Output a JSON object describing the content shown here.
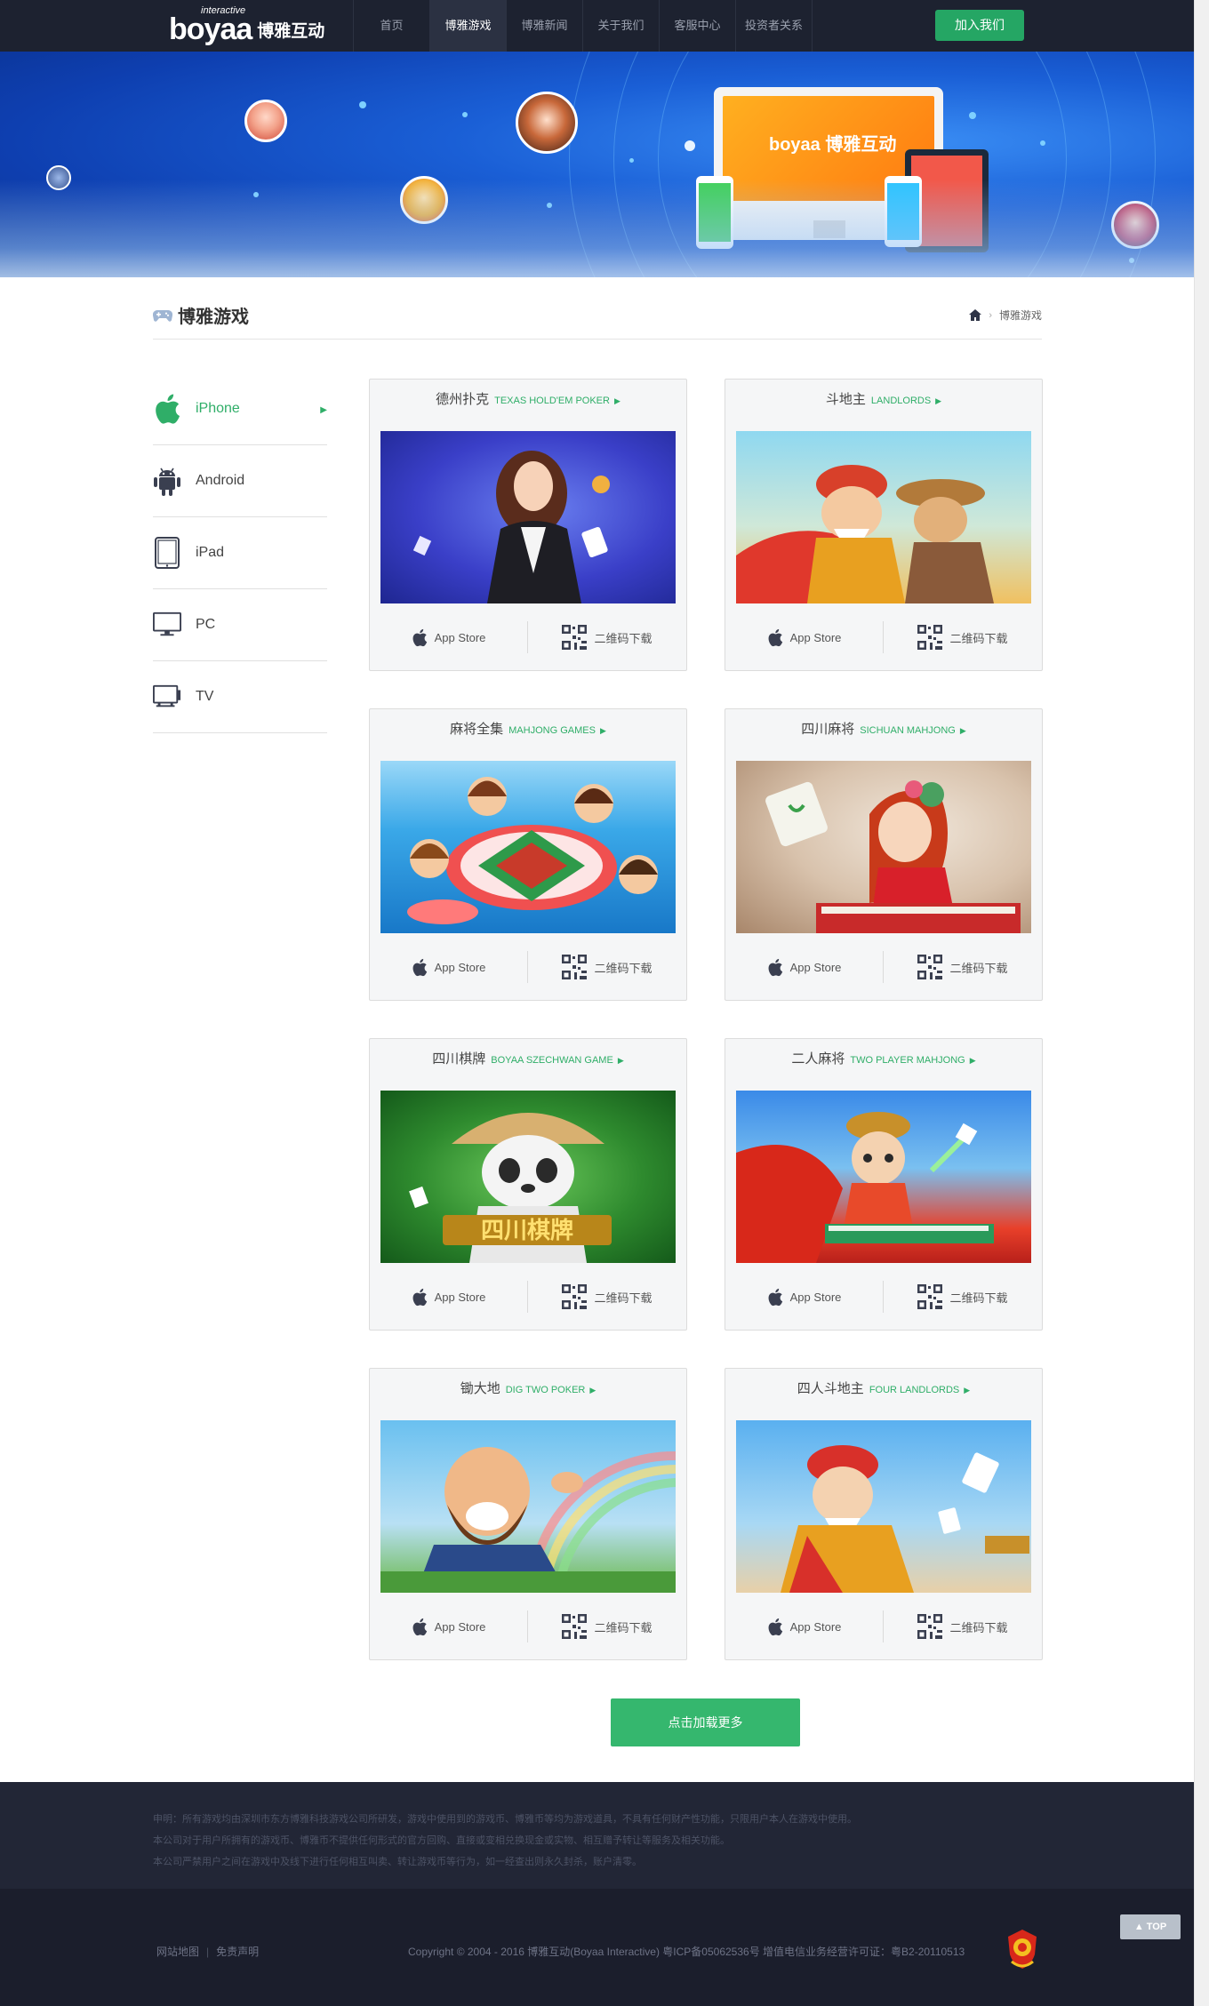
{
  "header": {
    "logo_word": "boyaa",
    "logo_sub": "interactive",
    "logo_cn": "博雅互动",
    "nav": [
      {
        "label": "首页",
        "active": false
      },
      {
        "label": "博雅游戏",
        "active": true
      },
      {
        "label": "博雅新闻",
        "active": false
      },
      {
        "label": "关于我们",
        "active": false
      },
      {
        "label": "客服中心",
        "active": false
      },
      {
        "label": "投资者关系",
        "active": false
      }
    ],
    "join_label": "加入我们"
  },
  "banner": {
    "screen_logo": "boyaa 博雅互动"
  },
  "page": {
    "title": "博雅游戏",
    "breadcrumb": "博雅游戏"
  },
  "sidebar": {
    "items": [
      {
        "label": "iPhone",
        "icon": "apple-icon",
        "active": true
      },
      {
        "label": "Android",
        "icon": "android-icon",
        "active": false
      },
      {
        "label": "iPad",
        "icon": "tablet-icon",
        "active": false
      },
      {
        "label": "PC",
        "icon": "monitor-icon",
        "active": false
      },
      {
        "label": "TV",
        "icon": "tv-icon",
        "active": false
      }
    ]
  },
  "cards": {
    "appstore_label": "App Store",
    "qr_label": "二维码下载",
    "games": [
      {
        "cn": "德州扑克",
        "en": "TEXAS HOLD'EM POKER"
      },
      {
        "cn": "斗地主",
        "en": "LANDLORDS"
      },
      {
        "cn": "麻将全集",
        "en": "MAHJONG GAMES"
      },
      {
        "cn": "四川麻将",
        "en": "SICHUAN MAHJONG"
      },
      {
        "cn": "四川棋牌",
        "en": "BOYAA SZECHWAN GAME"
      },
      {
        "cn": "二人麻将",
        "en": "TWO PLAYER MAHJONG"
      },
      {
        "cn": "锄大地",
        "en": "DIG TWO POKER"
      },
      {
        "cn": "四人斗地主",
        "en": "FOUR LANDLORDS"
      }
    ]
  },
  "load_more": "点击加载更多",
  "notice": {
    "line1": "申明：所有游戏均由深圳市东方博雅科技游戏公司所研发，游戏中使用到的游戏币、博雅币等均为游戏道具，不具有任何财产性功能，只限用户本人在游戏中使用。",
    "line2": "本公司对于用户所拥有的游戏币、博雅币不提供任何形式的官方回购、直接或变相兑换现金或实物、相互赠予转让等服务及相关功能。",
    "line3": "本公司严禁用户之间在游戏中及线下进行任何相互叫卖、转让游戏币等行为，如一经查出则永久封杀，账户清零。"
  },
  "footer": {
    "sitemap": "网站地图",
    "disclaimer": "免责声明",
    "copyright": "Copyright © 2004 - 2016 博雅互动(Boyaa Interactive)  粤ICP备05062536号  增值电信业务经营许可证：粤B2-20110513"
  },
  "top_label": "TOP",
  "colors": {
    "accent_green": "#2fae68",
    "header_bg": "#1d2230",
    "footer_bg": "#1b1e2c"
  }
}
